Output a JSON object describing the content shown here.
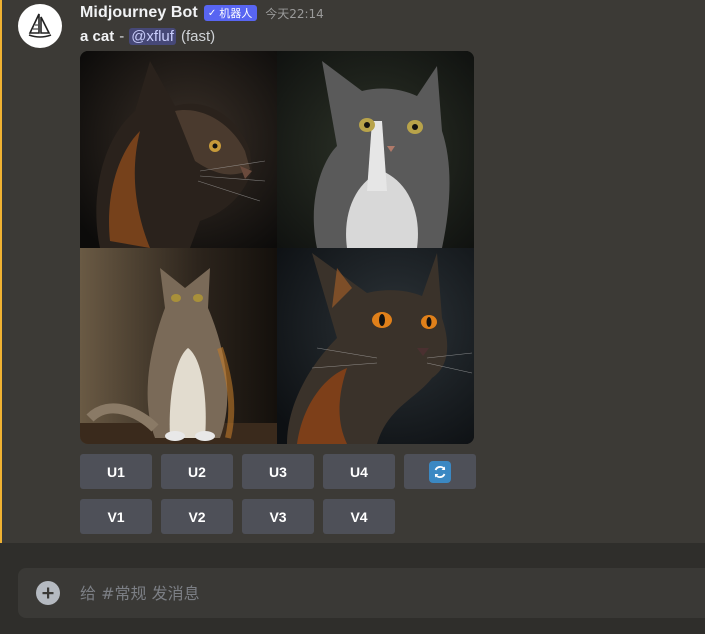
{
  "message": {
    "author": "Midjourney Bot",
    "bot_tag": "机器人",
    "bot_tag_check": "✓",
    "timestamp": "今天22:14",
    "prompt": "a cat",
    "separator": "-",
    "mention": "@xfluf",
    "mode": "(fast)",
    "avatar_icon": "sailboat-icon",
    "image_grid": {
      "tiles": [
        {
          "subject": "dark tabby cat in profile"
        },
        {
          "subject": "grey and white long-haired cat"
        },
        {
          "subject": "fluffy long-haired cat sitting"
        },
        {
          "subject": "dark tabby cat with orange eyes"
        }
      ]
    },
    "buttons": {
      "upscale": [
        "U1",
        "U2",
        "U3",
        "U4"
      ],
      "variation": [
        "V1",
        "V2",
        "V3",
        "V4"
      ],
      "reroll_icon": "refresh-icon"
    }
  },
  "composer": {
    "placeholder": "给 #常规 发消息",
    "value": "",
    "add_icon": "plus-circle-icon"
  },
  "colors": {
    "background": "#3c3a36",
    "composer_bg": "#3a3936",
    "button": "#4e5058",
    "bot_tag": "#5865f2",
    "accent_bar": "#f0b232",
    "reroll": "#3b88c3"
  }
}
